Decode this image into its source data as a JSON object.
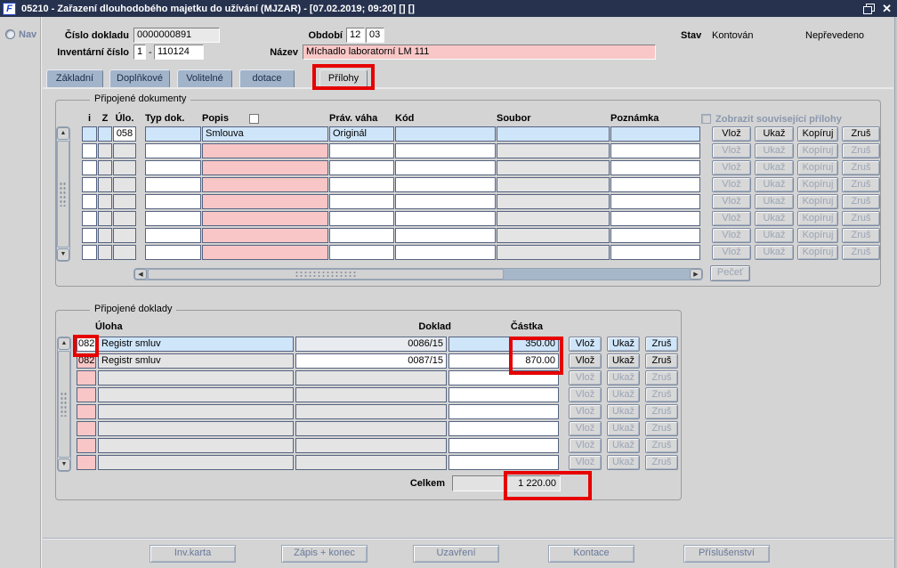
{
  "window": {
    "icon_glyph": "F",
    "title": "05210 - Zařazení dlouhodobého majetku do užívání (MJZAR) - [07.02.2019; 09:20] [] []"
  },
  "nav": {
    "label": "Nav"
  },
  "header": {
    "cislo_dokladu_label": "Číslo dokladu",
    "cislo_dokladu_value": "0000000891",
    "obdobi_label": "Období",
    "obdobi_month": "12",
    "obdobi_part": "03",
    "stav_label": "Stav",
    "stav_value": "Kontován",
    "stav_value2": "Nepřevedeno",
    "inv_label": "Inventární číslo",
    "inv_prefix": "1",
    "inv_sep": "-",
    "inv_number": "110124",
    "nazev_label": "Název",
    "nazev_value": "Míchadlo laboratorní LM 111"
  },
  "tabs": [
    {
      "label": "Základní",
      "active": false
    },
    {
      "label": "Doplňkové",
      "active": false
    },
    {
      "label": "Volitelné",
      "active": false
    },
    {
      "label": "dotace",
      "active": false
    },
    {
      "label": "Přílohy",
      "active": true,
      "annotated": true
    }
  ],
  "documents": {
    "group_title": "Připojené dokumenty",
    "headers": {
      "i": "i",
      "z": "Z",
      "ulo": "Úlo.",
      "typ": "Typ dok.",
      "popis": "Popis",
      "prav": "Práv. váha",
      "kod": "Kód",
      "soubor": "Soubor",
      "poznamka": "Poznámka"
    },
    "show_related_label": "Zobrazit související přílohy",
    "row_buttons": [
      "Vlož",
      "Ukaž",
      "Kopíruj",
      "Zruš"
    ],
    "pecet_label": "Pečeť",
    "rows": [
      {
        "i": "",
        "z": "",
        "ulo": "058",
        "typ": "",
        "popis": "Smlouva",
        "prav": "Originál",
        "kod": "",
        "soubor": "",
        "poznamka": "",
        "style": "selected",
        "buttons_enabled": true
      },
      {
        "i": "",
        "z": "",
        "ulo": "",
        "typ": "",
        "popis": "",
        "prav": "",
        "kod": "",
        "soubor": "",
        "poznamka": "",
        "style": "empty",
        "buttons_enabled": false
      },
      {
        "i": "",
        "z": "",
        "ulo": "",
        "typ": "",
        "popis": "",
        "prav": "",
        "kod": "",
        "soubor": "",
        "poznamka": "",
        "style": "empty",
        "buttons_enabled": false
      },
      {
        "i": "",
        "z": "",
        "ulo": "",
        "typ": "",
        "popis": "",
        "prav": "",
        "kod": "",
        "soubor": "",
        "poznamka": "",
        "style": "empty",
        "buttons_enabled": false
      },
      {
        "i": "",
        "z": "",
        "ulo": "",
        "typ": "",
        "popis": "",
        "prav": "",
        "kod": "",
        "soubor": "",
        "poznamka": "",
        "style": "empty",
        "buttons_enabled": false
      },
      {
        "i": "",
        "z": "",
        "ulo": "",
        "typ": "",
        "popis": "",
        "prav": "",
        "kod": "",
        "soubor": "",
        "poznamka": "",
        "style": "empty",
        "buttons_enabled": false
      },
      {
        "i": "",
        "z": "",
        "ulo": "",
        "typ": "",
        "popis": "",
        "prav": "",
        "kod": "",
        "soubor": "",
        "poznamka": "",
        "style": "empty",
        "buttons_enabled": false
      },
      {
        "i": "",
        "z": "",
        "ulo": "",
        "typ": "",
        "popis": "",
        "prav": "",
        "kod": "",
        "soubor": "",
        "poznamka": "",
        "style": "empty",
        "buttons_enabled": false
      }
    ]
  },
  "receipts": {
    "group_title": "Připojené doklady",
    "headers": {
      "uloha": "Úloha",
      "doklad": "Doklad",
      "castka": "Částka"
    },
    "row_buttons": [
      "Vlož",
      "Ukaž",
      "Zruš"
    ],
    "rows": [
      {
        "code": "082",
        "desc": "Registr smluv",
        "doklad": "0086/15",
        "amount": "350.00",
        "style": "selected",
        "buttons_enabled": true
      },
      {
        "code": "082",
        "desc": "Registr smluv",
        "doklad": "0087/15",
        "amount": "870.00",
        "style": "filled",
        "buttons_enabled": true
      },
      {
        "code": "",
        "desc": "",
        "doklad": "",
        "amount": "",
        "style": "empty",
        "buttons_enabled": false
      },
      {
        "code": "",
        "desc": "",
        "doklad": "",
        "amount": "",
        "style": "empty",
        "buttons_enabled": false
      },
      {
        "code": "",
        "desc": "",
        "doklad": "",
        "amount": "",
        "style": "empty",
        "buttons_enabled": false
      },
      {
        "code": "",
        "desc": "",
        "doklad": "",
        "amount": "",
        "style": "empty",
        "buttons_enabled": false
      },
      {
        "code": "",
        "desc": "",
        "doklad": "",
        "amount": "",
        "style": "empty",
        "buttons_enabled": false
      },
      {
        "code": "",
        "desc": "",
        "doklad": "",
        "amount": "",
        "style": "empty",
        "buttons_enabled": false
      }
    ],
    "total_label": "Celkem",
    "total_value": "1 220.00"
  },
  "footer": {
    "buttons": [
      "Inv.karta",
      "Zápis + konec",
      "Uzavření",
      "Kontace",
      "Příslušenství"
    ]
  },
  "colors": {
    "titlebar": "#26324e",
    "selected_row": "#cfe5f9",
    "required_pink": "#f8c6c6",
    "annotation_red": "#e60000",
    "panel": "#d4d4d4"
  }
}
